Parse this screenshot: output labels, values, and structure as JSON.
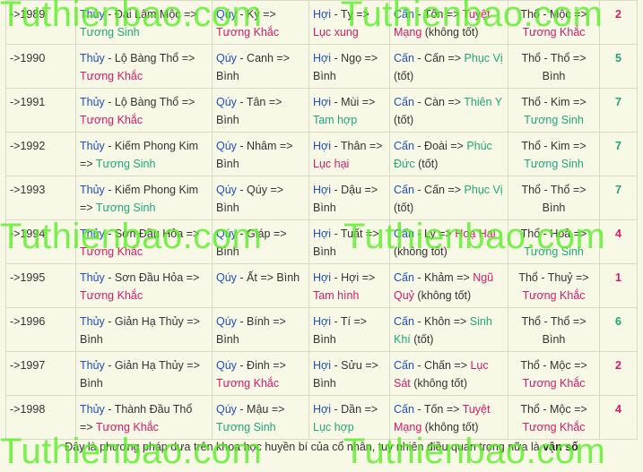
{
  "rows": [
    {
      "year": "->1989",
      "menh_k": "Thủy",
      "menh_v": " - Đại Lâm Mộc  => ",
      "menh_r": "Tương Sinh",
      "menh_rc": "green",
      "can_k": "Qúy",
      "can_v": " - Kỷ  => ",
      "can_r": "Tương Khắc",
      "can_rc": "red",
      "chi_k": "Hợi",
      "chi_v": " - Tỵ  => ",
      "chi_r": "Lục xung",
      "chi_rc": "red",
      "que_k": "Cấn",
      "que_v": " - Tốn  => ",
      "que_r": "Tuyệt Mạng",
      "que_rc": "red",
      "que_t": " (không tốt)",
      "tho_v": "Thổ - Mộc => ",
      "tho_r": "Tương Khắc",
      "tho_rc": "red",
      "score": "2",
      "score_c": "r"
    },
    {
      "year": "->1990",
      "menh_k": "Thủy",
      "menh_v": " - Lộ Bàng Thổ  => ",
      "menh_r": "Tương Khắc",
      "menh_rc": "red",
      "can_k": "Qúy",
      "can_v": " - Canh  => ",
      "can_r": "Bình",
      "can_rc": "plain",
      "chi_k": "Hợi",
      "chi_v": " - Ngọ  => ",
      "chi_r": "Bình",
      "chi_rc": "plain",
      "que_k": "Cấn",
      "que_v": " - Cấn  => ",
      "que_r": "Phục Vị",
      "que_rc": "green",
      "que_t": " (tốt)",
      "tho_v": "Thổ - Thổ => ",
      "tho_r": "Bình",
      "tho_rc": "plain",
      "score": "5",
      "score_c": "g"
    },
    {
      "year": "->1991",
      "menh_k": "Thủy",
      "menh_v": " - Lộ Bàng Thổ  => ",
      "menh_r": "Tương Khắc",
      "menh_rc": "red",
      "can_k": "Qúy",
      "can_v": " - Tân  => ",
      "can_r": "Bình",
      "can_rc": "plain",
      "chi_k": "Hợi",
      "chi_v": " - Mùi  => ",
      "chi_r": "Tam hợp",
      "chi_rc": "green",
      "que_k": "Cấn",
      "que_v": " - Càn  => ",
      "que_r": "Thiên Y",
      "que_rc": "green",
      "que_t": " (tốt)",
      "tho_v": "Thổ - Kim => ",
      "tho_r": "Tương Sinh",
      "tho_rc": "green",
      "score": "7",
      "score_c": "g"
    },
    {
      "year": "->1992",
      "menh_k": "Thủy",
      "menh_v": " - Kiếm Phong Kim  => ",
      "menh_r": "Tương Sinh",
      "menh_rc": "green",
      "can_k": "Qúy",
      "can_v": " - Nhâm  => ",
      "can_r": "Bình",
      "can_rc": "plain",
      "chi_k": "Hợi",
      "chi_v": " - Thân  => ",
      "chi_r": "Lục hại",
      "chi_rc": "red",
      "que_k": "Cấn",
      "que_v": " - Đoài  => ",
      "que_r": "Phúc Đức",
      "que_rc": "green",
      "que_t": " (tốt)",
      "tho_v": "Thổ - Kim => ",
      "tho_r": "Tương Sinh",
      "tho_rc": "green",
      "score": "7",
      "score_c": "g"
    },
    {
      "year": "->1993",
      "menh_k": "Thủy",
      "menh_v": " - Kiếm Phong Kim  => ",
      "menh_r": "Tương Sinh",
      "menh_rc": "green",
      "can_k": "Qúy",
      "can_v": " - Qúy  => ",
      "can_r": "Bình",
      "can_rc": "plain",
      "chi_k": "Hợi",
      "chi_v": " - Dậu  => ",
      "chi_r": "Bình",
      "chi_rc": "plain",
      "que_k": "Cấn",
      "que_v": " - Cấn  => ",
      "que_r": "Phục Vị",
      "que_rc": "green",
      "que_t": " (tốt)",
      "tho_v": "Thổ - Thổ => ",
      "tho_r": "Bình",
      "tho_rc": "plain",
      "score": "7",
      "score_c": "g"
    },
    {
      "year": "->1994",
      "menh_k": "Thủy",
      "menh_v": " - Sơn Đầu Hỏa  => ",
      "menh_r": "Tương Khắc",
      "menh_rc": "red",
      "can_k": "Qúy",
      "can_v": " - Giáp  => ",
      "can_r": "Bình",
      "can_rc": "plain",
      "chi_k": "Hợi",
      "chi_v": " - Tuất  => ",
      "chi_r": "Bình",
      "chi_rc": "plain",
      "que_k": "Cấn",
      "que_v": " - Ly  => ",
      "que_r": "Hoạ Hại",
      "que_rc": "red",
      "que_t": " (không tốt)",
      "tho_v": "Thổ - Hoả => ",
      "tho_r": "Tương Sinh",
      "tho_rc": "green",
      "score": "4",
      "score_c": "r"
    },
    {
      "year": "->1995",
      "menh_k": "Thủy",
      "menh_v": " - Sơn Đầu Hỏa  => ",
      "menh_r": "Tương Khắc",
      "menh_rc": "red",
      "can_k": "Qúy",
      "can_v": " - Ất  => ",
      "can_r": "Bình",
      "can_rc": "plain",
      "chi_k": "Hợi",
      "chi_v": " - Hợi  => ",
      "chi_r": "Tam hình",
      "chi_rc": "red",
      "que_k": "Cấn",
      "que_v": " - Khảm  => ",
      "que_r": "Ngũ Quỷ",
      "que_rc": "red",
      "que_t": " (không tốt)",
      "tho_v": "Thổ - Thuỷ => ",
      "tho_r": "Tương Khắc",
      "tho_rc": "red",
      "score": "1",
      "score_c": "r"
    },
    {
      "year": "->1996",
      "menh_k": "Thủy",
      "menh_v": " - Giản Hạ Thủy  => ",
      "menh_r": "Bình",
      "menh_rc": "plain",
      "can_k": "Qúy",
      "can_v": " - Bính  => ",
      "can_r": "Bình",
      "can_rc": "plain",
      "chi_k": "Hợi",
      "chi_v": " - Tí  => ",
      "chi_r": "Bình",
      "chi_rc": "plain",
      "que_k": "Cấn",
      "que_v": " - Khôn  => ",
      "que_r": "Sinh Khí",
      "que_rc": "green",
      "que_t": " (tốt)",
      "tho_v": "Thổ - Thổ => ",
      "tho_r": "Bình",
      "tho_rc": "plain",
      "score": "6",
      "score_c": "g"
    },
    {
      "year": "->1997",
      "menh_k": "Thủy",
      "menh_v": " - Giản Hạ Thủy  => ",
      "menh_r": "Bình",
      "menh_rc": "plain",
      "can_k": "Qúy",
      "can_v": " - Đinh  => ",
      "can_r": "Tương Khắc",
      "can_rc": "red",
      "chi_k": "Hợi",
      "chi_v": " - Sửu  => ",
      "chi_r": "Bình",
      "chi_rc": "plain",
      "que_k": "Cấn",
      "que_v": " - Chấn  => ",
      "que_r": "Lục Sát",
      "que_rc": "red",
      "que_t": " (không tốt)",
      "tho_v": "Thổ - Mộc => ",
      "tho_r": "Tương Khắc",
      "tho_rc": "red",
      "score": "2",
      "score_c": "r"
    },
    {
      "year": "->1998",
      "menh_k": "Thủy",
      "menh_v": " - Thành Đầu Thổ  => ",
      "menh_r": "Tương Khắc",
      "menh_rc": "red",
      "can_k": "Qúy",
      "can_v": " - Mậu  => ",
      "can_r": "Tương Sinh",
      "can_rc": "green",
      "chi_k": "Hợi",
      "chi_v": " - Dần  => ",
      "chi_r": "Lục hợp",
      "chi_rc": "green",
      "que_k": "Cấn",
      "que_v": " - Tốn  => ",
      "que_r": "Tuyệt Mạng",
      "que_rc": "red",
      "que_t": " (không tốt)",
      "tho_v": "Thổ - Mộc => ",
      "tho_r": "Tương Khắc",
      "tho_rc": "red",
      "score": "4",
      "score_c": "r"
    }
  ],
  "footer": {
    "text": "Đây là phương pháp dựa trên khoa học huyền bí của cổ nhân, tuy nhiên điều quan trọng nữa là ",
    "bold": "vận số"
  },
  "watermark": "Tuthienbao.com",
  "colors": {
    "accent_blue": "#1f4fb8",
    "good_green": "#21a67a",
    "bad_red": "#d41a6a",
    "watermark_green": "#55ee22",
    "background": "#f8f8e6"
  }
}
